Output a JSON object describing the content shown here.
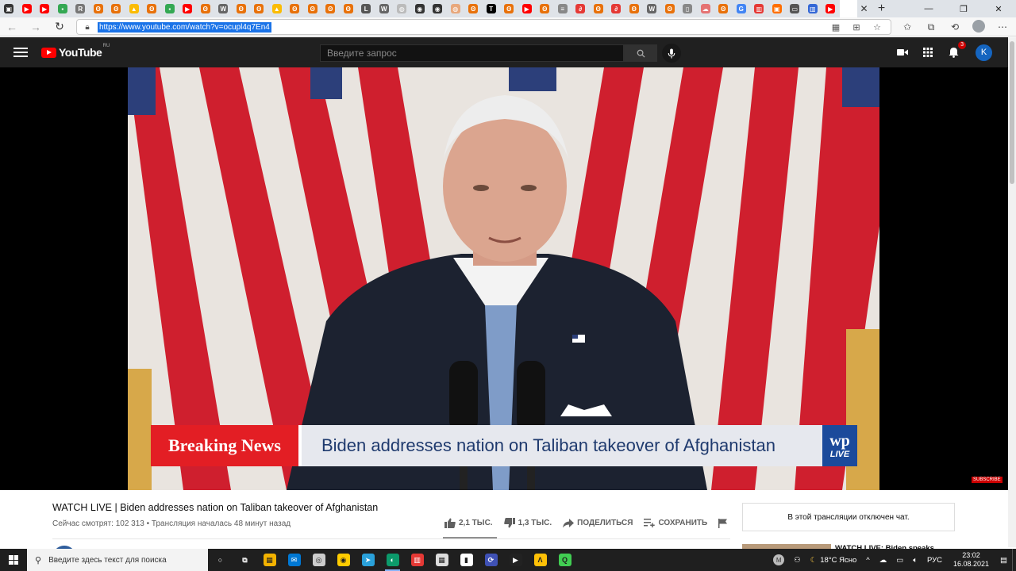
{
  "browser": {
    "tabs": [
      {
        "icon": "sidebar-icon",
        "color": "#333333",
        "glyph": "▣"
      },
      {
        "icon": "youtube-favicon",
        "color": "#ff0000",
        "glyph": "▶"
      },
      {
        "icon": "youtube-favicon",
        "color": "#ff0000",
        "glyph": "▶"
      },
      {
        "icon": "green-favicon",
        "color": "#34a853",
        "glyph": "▪"
      },
      {
        "icon": "r-favicon",
        "color": "#777777",
        "glyph": "R"
      },
      {
        "icon": "site-favicon",
        "color": "#e8710a",
        "glyph": "ʘ"
      },
      {
        "icon": "site-favicon",
        "color": "#e8710a",
        "glyph": "ʘ"
      },
      {
        "icon": "drive-favicon",
        "color": "#fbbc04",
        "glyph": "▲"
      },
      {
        "icon": "site-favicon",
        "color": "#e8710a",
        "glyph": "ʘ"
      },
      {
        "icon": "green-favicon",
        "color": "#34a853",
        "glyph": "▪"
      },
      {
        "icon": "youtube-favicon",
        "color": "#ff0000",
        "glyph": "▶"
      },
      {
        "icon": "site-favicon",
        "color": "#e8710a",
        "glyph": "ʘ"
      },
      {
        "icon": "wikipedia-favicon",
        "color": "#666666",
        "glyph": "W"
      },
      {
        "icon": "site-favicon",
        "color": "#e8710a",
        "glyph": "ʘ"
      },
      {
        "icon": "site-favicon",
        "color": "#e8710a",
        "glyph": "ʘ"
      },
      {
        "icon": "drive-favicon",
        "color": "#fbbc04",
        "glyph": "▲"
      },
      {
        "icon": "site-favicon",
        "color": "#e8710a",
        "glyph": "ʘ"
      },
      {
        "icon": "site-favicon",
        "color": "#e8710a",
        "glyph": "ʘ"
      },
      {
        "icon": "site-favicon",
        "color": "#e8710a",
        "glyph": "ʘ"
      },
      {
        "icon": "site-favicon",
        "color": "#e8710a",
        "glyph": "ʘ"
      },
      {
        "icon": "l-favicon",
        "color": "#555555",
        "glyph": "L"
      },
      {
        "icon": "wikipedia-favicon",
        "color": "#666666",
        "glyph": "W"
      },
      {
        "icon": "generic-favicon",
        "color": "#bbbbbb",
        "glyph": "◍"
      },
      {
        "icon": "github-favicon",
        "color": "#333333",
        "glyph": "◉"
      },
      {
        "icon": "github-favicon",
        "color": "#333333",
        "glyph": "◉"
      },
      {
        "icon": "generic-favicon",
        "color": "#e8a87c",
        "glyph": "◍"
      },
      {
        "icon": "site-favicon",
        "color": "#e8710a",
        "glyph": "ʘ"
      },
      {
        "icon": "t-favicon",
        "color": "#000000",
        "glyph": "T"
      },
      {
        "icon": "site-favicon",
        "color": "#e8710a",
        "glyph": "ʘ"
      },
      {
        "icon": "youtube-favicon",
        "color": "#ff0000",
        "glyph": "▶"
      },
      {
        "icon": "site-favicon",
        "color": "#e8710a",
        "glyph": "ʘ"
      },
      {
        "icon": "doc-favicon",
        "color": "#888888",
        "glyph": "≡"
      },
      {
        "icon": "red-swirl-favicon",
        "color": "#e53935",
        "glyph": "∂"
      },
      {
        "icon": "site-favicon",
        "color": "#e8710a",
        "glyph": "ʘ"
      },
      {
        "icon": "red-swirl-favicon",
        "color": "#e53935",
        "glyph": "∂"
      },
      {
        "icon": "site-favicon",
        "color": "#e8710a",
        "glyph": "ʘ"
      },
      {
        "icon": "wikipedia-favicon",
        "color": "#666666",
        "glyph": "W"
      },
      {
        "icon": "site-favicon",
        "color": "#e8710a",
        "glyph": "ʘ"
      },
      {
        "icon": "page-favicon",
        "color": "#888888",
        "glyph": "▯"
      },
      {
        "icon": "cloud-favicon",
        "color": "#e57373",
        "glyph": "☁"
      },
      {
        "icon": "site-favicon",
        "color": "#e8710a",
        "glyph": "ʘ"
      },
      {
        "icon": "google-favicon",
        "color": "#4285f4",
        "glyph": "G"
      },
      {
        "icon": "chart-favicon",
        "color": "#e53935",
        "glyph": "▥"
      },
      {
        "icon": "orange-favicon",
        "color": "#ff6f00",
        "glyph": "▣"
      },
      {
        "icon": "generic-favicon",
        "color": "#555555",
        "glyph": "▭"
      },
      {
        "icon": "chart-favicon",
        "color": "#3367d6",
        "glyph": "▥"
      },
      {
        "icon": "youtube-favicon",
        "color": "#ff0000",
        "glyph": "▶"
      }
    ],
    "active_tab_close": "✕",
    "new_tab": "+",
    "window_controls": {
      "minimize": "—",
      "restore": "❐",
      "close": "✕"
    },
    "url": "https://www.youtube.com/watch?v=ocupl4q7En4"
  },
  "youtube": {
    "logo_text": "YouTube",
    "region": "RU",
    "search_placeholder": "Введите запрос",
    "notification_count": "3",
    "avatar_letter": "K"
  },
  "video": {
    "breaking_label": "Breaking News",
    "headline": "Biden addresses nation on Taliban takeover of Afghanistan",
    "wp_mark": "wp",
    "wp_live": "LIVE",
    "subscribe_watermark": "SUBSCRIBE",
    "title": "WATCH LIVE | Biden addresses nation on Taliban takeover of Afghanistan",
    "meta": "Сейчас смотрят: 102 313 • Трансляция началась 48 минут назад",
    "likes": "2,1 ТЫС.",
    "dislikes": "1,3 ТЫС.",
    "share_label": "ПОДЕЛИТЬСЯ",
    "save_label": "СОХРАНИТЬ"
  },
  "sidebar": {
    "chat_disabled": "В этой трансляции отключен чат.",
    "recommendation_title": "WATCH LIVE: Biden speaks"
  },
  "taskbar": {
    "search_placeholder": "Введите здесь текст для поиска",
    "apps": [
      {
        "name": "cortana",
        "glyph": "○",
        "bg": "transparent",
        "fg": "#ffffff"
      },
      {
        "name": "task-view",
        "glyph": "⧉",
        "bg": "transparent",
        "fg": "#ffffff"
      },
      {
        "name": "store",
        "glyph": "▦",
        "bg": "#f3b200",
        "fg": "#1f1f1f"
      },
      {
        "name": "mail",
        "glyph": "✉",
        "bg": "#0078d4",
        "fg": "#ffffff"
      },
      {
        "name": "steam",
        "glyph": "◎",
        "bg": "#cccccc",
        "fg": "#1f1f1f"
      },
      {
        "name": "yandex-music",
        "glyph": "◉",
        "bg": "#ffcc00",
        "fg": "#1f1f1f"
      },
      {
        "name": "telegram",
        "glyph": "➤",
        "bg": "#2aa1da",
        "fg": "#ffffff"
      },
      {
        "name": "edge",
        "glyph": "◐",
        "bg": "#0c9a6b",
        "fg": "#ffffff"
      },
      {
        "name": "stats",
        "glyph": "▥",
        "bg": "#e53935",
        "fg": "#ffffff"
      },
      {
        "name": "mixer",
        "glyph": "▦",
        "bg": "#dddddd",
        "fg": "#1f1f1f"
      },
      {
        "name": "itch",
        "glyph": "▮",
        "bg": "#ffffff",
        "fg": "#1f1f1f"
      },
      {
        "name": "radeon",
        "glyph": "⟳",
        "bg": "#3f51b5",
        "fg": "#ffffff"
      },
      {
        "name": "terminal",
        "glyph": "▶",
        "bg": "#222222",
        "fg": "#ffffff"
      },
      {
        "name": "arch-app",
        "glyph": "Λ",
        "bg": "#ffc107",
        "fg": "#1f1f1f"
      },
      {
        "name": "qt-app",
        "glyph": "Q",
        "bg": "#41cd52",
        "fg": "#1f1f1f"
      }
    ],
    "weather": "18°C Ясно",
    "language": "РУС",
    "time": "23:02",
    "date": "16.08.2021"
  },
  "colors": {
    "yt_dark": "#202020",
    "yt_red": "#ff0000",
    "breaking_red": "#e31e24",
    "wp_blue": "#1b4a9b",
    "url_highlight": "#1a73e8"
  }
}
